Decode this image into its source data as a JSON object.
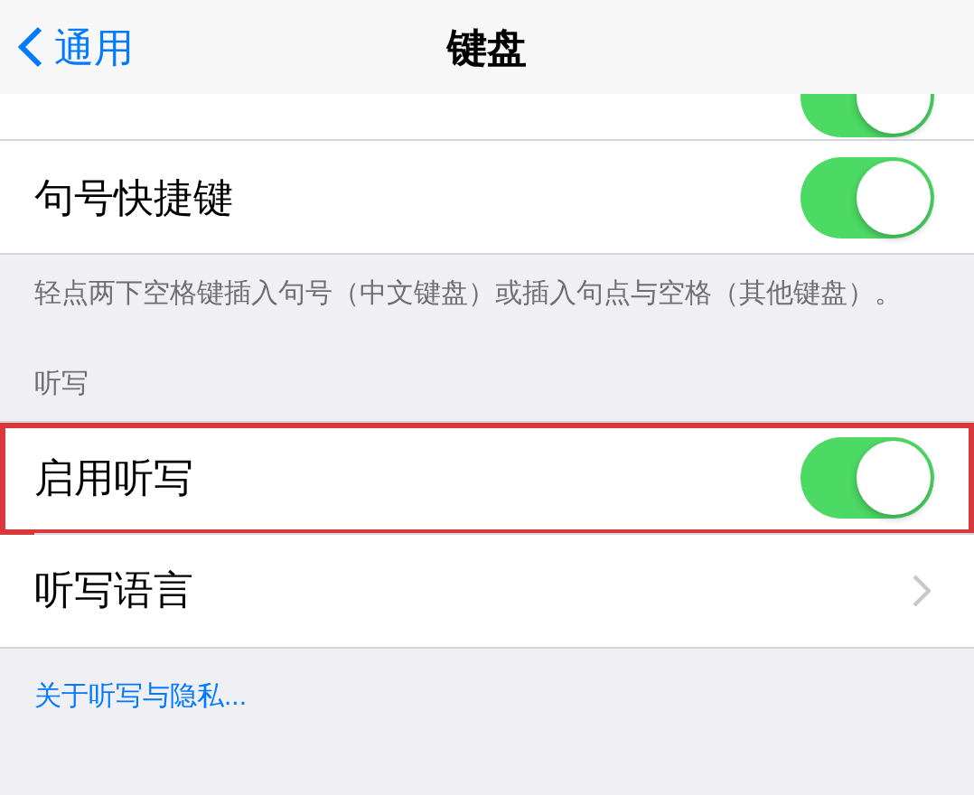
{
  "nav": {
    "back": "通用",
    "title": "键盘"
  },
  "partial_row": {
    "on": true
  },
  "rows": [
    {
      "kind": "toggle",
      "label": "句号快捷键",
      "on": true,
      "highlighted": false
    }
  ],
  "footer": "轻点两下空格键插入句号（中文键盘）或插入句点与空格（其他键盘）。",
  "section_header": "听写",
  "dictation_rows": [
    {
      "kind": "toggle",
      "label": "启用听写",
      "on": true,
      "highlighted": true
    },
    {
      "kind": "link",
      "label": "听写语言",
      "highlighted": false
    }
  ],
  "privacy_link": "关于听写与隐私..."
}
